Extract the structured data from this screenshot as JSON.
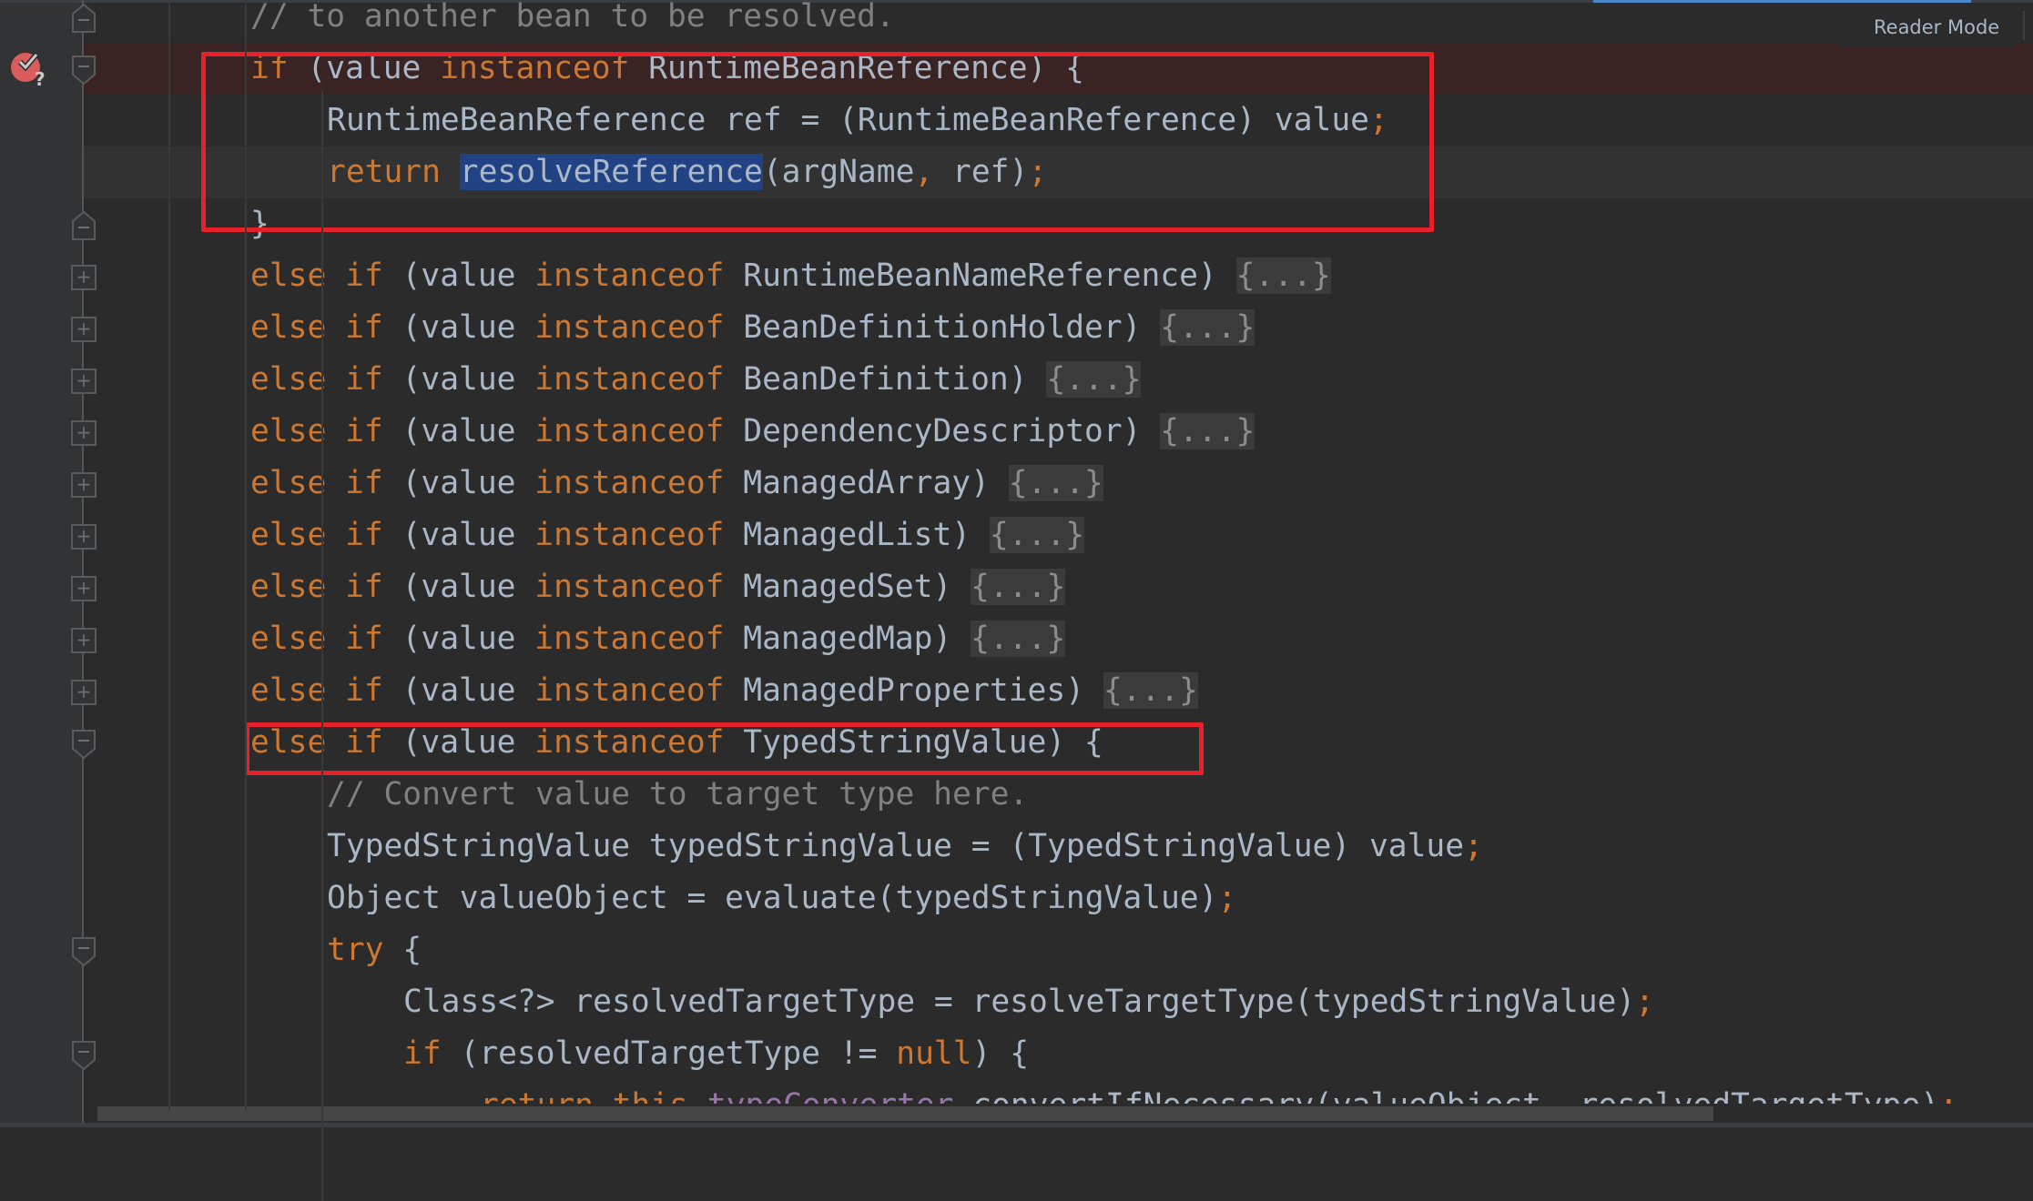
{
  "editor": {
    "reader_mode_label": "Reader Mode",
    "colors": {
      "background": "#2b2b2b",
      "keyword": "#cc7832",
      "identifier": "#a9b7c6",
      "comment": "#808080",
      "field": "#9876aa",
      "selection": "#214283",
      "breakpoint_line": "#3a2323",
      "annotation_box": "#e8202a"
    },
    "breakpoint": {
      "icon": "conditional-breakpoint-icon",
      "line_index": 1
    },
    "lines": [
      {
        "indent": 0,
        "tokens": [
          {
            "t": "// to another bean to be resolved.",
            "c": "cm"
          }
        ]
      },
      {
        "indent": 0,
        "tokens": [
          {
            "t": "if",
            "c": "kw"
          },
          {
            "t": " (value "
          },
          {
            "t": "instanceof",
            "c": "kw"
          },
          {
            "t": " RuntimeBeanReference) {"
          }
        ]
      },
      {
        "indent": 1,
        "tokens": [
          {
            "t": "RuntimeBeanReference ref = (RuntimeBeanReference) value"
          },
          {
            "t": ";",
            "c": "kw"
          }
        ]
      },
      {
        "indent": 1,
        "tokens": [
          {
            "t": "return",
            "c": "kw"
          },
          {
            "t": " "
          },
          {
            "t": "resolveReference",
            "c": "sel"
          },
          {
            "t": "(argName"
          },
          {
            "t": ",",
            "c": "kw"
          },
          {
            "t": " ref)"
          },
          {
            "t": ";",
            "c": "kw"
          }
        ]
      },
      {
        "indent": 0,
        "tokens": [
          {
            "t": "}"
          }
        ]
      },
      {
        "indent": 0,
        "tokens": [
          {
            "t": "else if",
            "c": "kw"
          },
          {
            "t": " (value "
          },
          {
            "t": "instanceof",
            "c": "kw"
          },
          {
            "t": " RuntimeBeanNameReference) "
          },
          {
            "t": "{...}",
            "c": "ph"
          }
        ]
      },
      {
        "indent": 0,
        "tokens": [
          {
            "t": "else if",
            "c": "kw"
          },
          {
            "t": " (value "
          },
          {
            "t": "instanceof",
            "c": "kw"
          },
          {
            "t": " BeanDefinitionHolder) "
          },
          {
            "t": "{...}",
            "c": "ph"
          }
        ]
      },
      {
        "indent": 0,
        "tokens": [
          {
            "t": "else if",
            "c": "kw"
          },
          {
            "t": " (value "
          },
          {
            "t": "instanceof",
            "c": "kw"
          },
          {
            "t": " BeanDefinition) "
          },
          {
            "t": "{...}",
            "c": "ph"
          }
        ]
      },
      {
        "indent": 0,
        "tokens": [
          {
            "t": "else if",
            "c": "kw"
          },
          {
            "t": " (value "
          },
          {
            "t": "instanceof",
            "c": "kw"
          },
          {
            "t": " DependencyDescriptor) "
          },
          {
            "t": "{...}",
            "c": "ph"
          }
        ]
      },
      {
        "indent": 0,
        "tokens": [
          {
            "t": "else if",
            "c": "kw"
          },
          {
            "t": " (value "
          },
          {
            "t": "instanceof",
            "c": "kw"
          },
          {
            "t": " ManagedArray) "
          },
          {
            "t": "{...}",
            "c": "ph"
          }
        ]
      },
      {
        "indent": 0,
        "tokens": [
          {
            "t": "else if",
            "c": "kw"
          },
          {
            "t": " (value "
          },
          {
            "t": "instanceof",
            "c": "kw"
          },
          {
            "t": " ManagedList) "
          },
          {
            "t": "{...}",
            "c": "ph"
          }
        ]
      },
      {
        "indent": 0,
        "tokens": [
          {
            "t": "else if",
            "c": "kw"
          },
          {
            "t": " (value "
          },
          {
            "t": "instanceof",
            "c": "kw"
          },
          {
            "t": " ManagedSet) "
          },
          {
            "t": "{...}",
            "c": "ph"
          }
        ]
      },
      {
        "indent": 0,
        "tokens": [
          {
            "t": "else if",
            "c": "kw"
          },
          {
            "t": " (value "
          },
          {
            "t": "instanceof",
            "c": "kw"
          },
          {
            "t": " ManagedMap) "
          },
          {
            "t": "{...}",
            "c": "ph"
          }
        ]
      },
      {
        "indent": 0,
        "tokens": [
          {
            "t": "else if",
            "c": "kw"
          },
          {
            "t": " (value "
          },
          {
            "t": "instanceof",
            "c": "kw"
          },
          {
            "t": " ManagedProperties) "
          },
          {
            "t": "{...}",
            "c": "ph"
          }
        ]
      },
      {
        "indent": 0,
        "tokens": [
          {
            "t": "else if",
            "c": "kw"
          },
          {
            "t": " (value "
          },
          {
            "t": "instanceof",
            "c": "kw"
          },
          {
            "t": " TypedStringValue) {"
          }
        ]
      },
      {
        "indent": 1,
        "tokens": [
          {
            "t": "// Convert value to target type here.",
            "c": "cm"
          }
        ]
      },
      {
        "indent": 1,
        "tokens": [
          {
            "t": "TypedStringValue typedStringValue = (TypedStringValue) value"
          },
          {
            "t": ";",
            "c": "kw"
          }
        ]
      },
      {
        "indent": 1,
        "tokens": [
          {
            "t": "Object valueObject = evaluate(typedStringValue)"
          },
          {
            "t": ";",
            "c": "kw"
          }
        ]
      },
      {
        "indent": 1,
        "tokens": [
          {
            "t": "try",
            "c": "kw"
          },
          {
            "t": " {"
          }
        ]
      },
      {
        "indent": 2,
        "tokens": [
          {
            "t": "Class<?> resolvedTargetType = resolveTargetType(typedStringValue)"
          },
          {
            "t": ";",
            "c": "kw"
          }
        ]
      },
      {
        "indent": 2,
        "tokens": [
          {
            "t": "if",
            "c": "kw"
          },
          {
            "t": " (resolvedTargetType != "
          },
          {
            "t": "null",
            "c": "kw"
          },
          {
            "t": ") {"
          }
        ]
      },
      {
        "indent": 3,
        "tokens": [
          {
            "t": "return this",
            "c": "kw"
          },
          {
            "t": "."
          },
          {
            "t": "typeConverter",
            "c": "fld"
          },
          {
            "t": ".convertIfNecessary(valueObject"
          },
          {
            "t": ",",
            "c": "kw"
          },
          {
            "t": " resolvedTargetType)"
          },
          {
            "t": ";",
            "c": "kw"
          }
        ]
      }
    ],
    "fold_markers": [
      {
        "line": 0,
        "type": "end"
      },
      {
        "line": 1,
        "type": "start"
      },
      {
        "line": 4,
        "type": "end"
      },
      {
        "line": 5,
        "type": "collapsed"
      },
      {
        "line": 6,
        "type": "collapsed"
      },
      {
        "line": 7,
        "type": "collapsed"
      },
      {
        "line": 8,
        "type": "collapsed"
      },
      {
        "line": 9,
        "type": "collapsed"
      },
      {
        "line": 10,
        "type": "collapsed"
      },
      {
        "line": 11,
        "type": "collapsed"
      },
      {
        "line": 12,
        "type": "collapsed"
      },
      {
        "line": 13,
        "type": "collapsed"
      },
      {
        "line": 14,
        "type": "start"
      },
      {
        "line": 18,
        "type": "start"
      },
      {
        "line": 20,
        "type": "start"
      }
    ],
    "annotations": [
      {
        "name": "highlight-runtime-bean-reference-block",
        "from_line": 1,
        "to_line": 4
      },
      {
        "name": "highlight-typed-string-value-line",
        "from_line": 14,
        "to_line": 14
      }
    ]
  }
}
